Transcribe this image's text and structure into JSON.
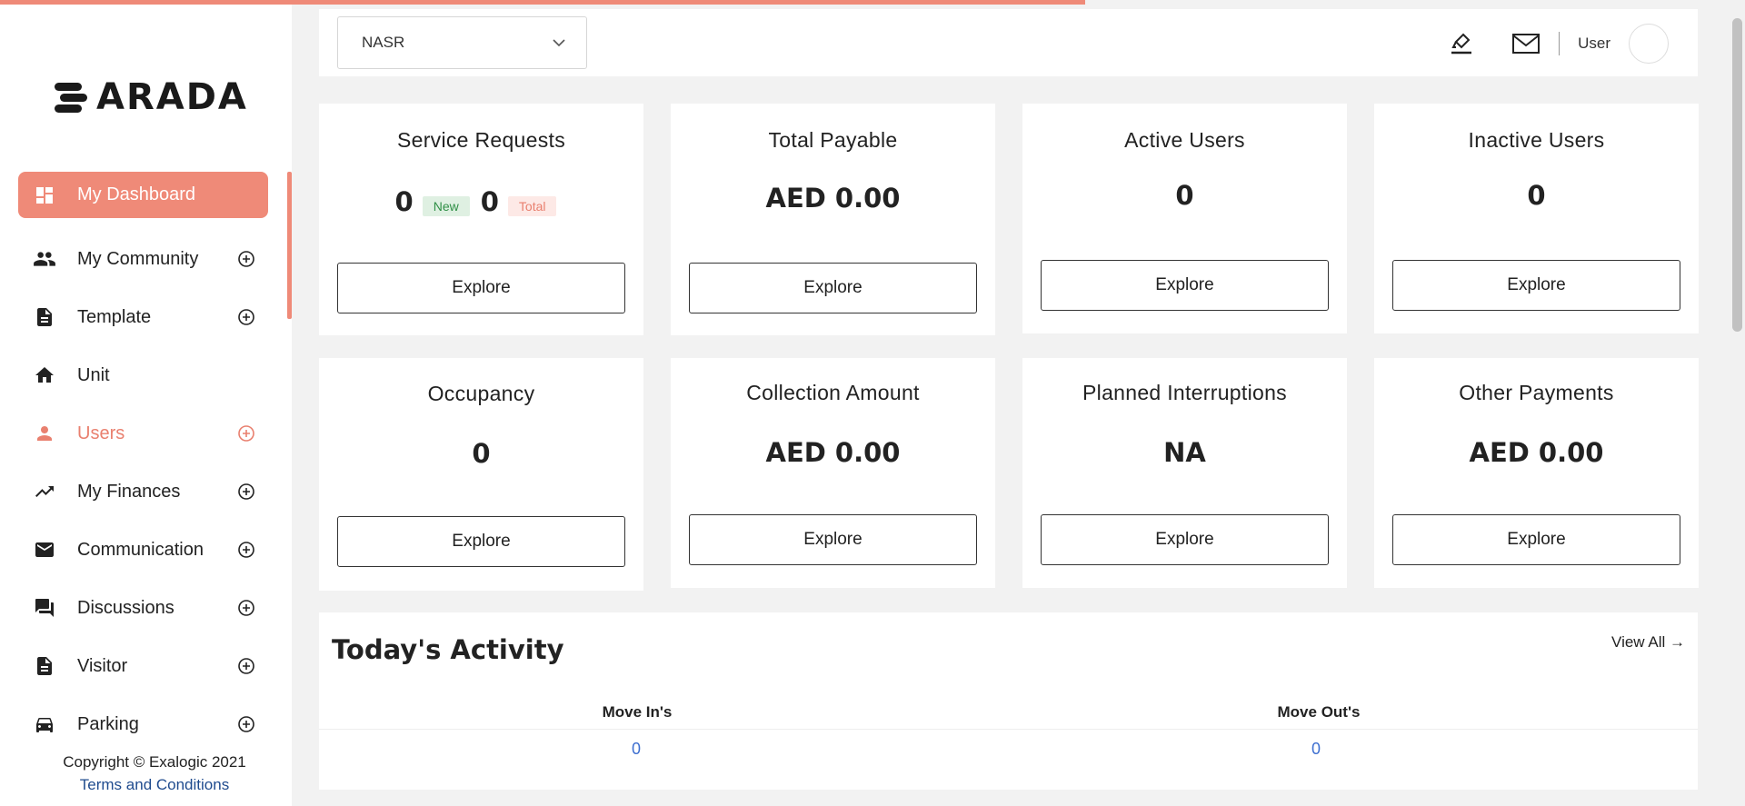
{
  "colors": {
    "accent": "#ef8a78",
    "link": "#1f4b8e",
    "value_link": "#3d6fd0"
  },
  "logo": {
    "text": "ARADA",
    "icon": "arada-logo-mark"
  },
  "sidebar": {
    "items": [
      {
        "label": "My Dashboard",
        "icon": "dashboard-icon",
        "expandable": false,
        "active": true
      },
      {
        "label": "My Community",
        "icon": "people-icon",
        "expandable": true
      },
      {
        "label": "Template",
        "icon": "document-icon",
        "expandable": true
      },
      {
        "label": "Unit",
        "icon": "home-icon",
        "expandable": false
      },
      {
        "label": "Users",
        "icon": "person-icon",
        "expandable": true,
        "highlight": true
      },
      {
        "label": "My Finances",
        "icon": "trending-up-icon",
        "expandable": true
      },
      {
        "label": "Communication",
        "icon": "mail-icon",
        "expandable": true
      },
      {
        "label": "Discussions",
        "icon": "forum-icon",
        "expandable": true
      },
      {
        "label": "Visitor",
        "icon": "document-icon",
        "expandable": true
      },
      {
        "label": "Parking",
        "icon": "car-icon",
        "expandable": true
      }
    ]
  },
  "footer": {
    "copyright": "Copyright © Exalogic 2021",
    "terms": "Terms and Conditions"
  },
  "header": {
    "community_select": "NASR",
    "user_name": "User",
    "icons": [
      "brush-icon",
      "mail-icon"
    ]
  },
  "cards": {
    "service_requests": {
      "title": "Service Requests",
      "new_count": "0",
      "new_label": "New",
      "total_count": "0",
      "total_label": "Total",
      "button": "Explore"
    },
    "total_payable": {
      "title": "Total Payable",
      "value": "AED 0.00",
      "button": "Explore"
    },
    "active_users": {
      "title": "Active Users",
      "value": "0",
      "button": "Explore"
    },
    "inactive_users": {
      "title": "Inactive Users",
      "value": "0",
      "button": "Explore"
    },
    "occupancy": {
      "title": "Occupancy",
      "value": "0",
      "button": "Explore"
    },
    "collection_amount": {
      "title": "Collection Amount",
      "value": "AED 0.00",
      "button": "Explore"
    },
    "planned_interruptions": {
      "title": "Planned Interruptions",
      "value": "NA",
      "button": "Explore"
    },
    "other_payments": {
      "title": "Other Payments",
      "value": "AED 0.00",
      "button": "Explore"
    }
  },
  "activity": {
    "title": "Today's Activity",
    "view_all": "View All",
    "move_ins_label": "Move In's",
    "move_ins_value": "0",
    "move_outs_label": "Move Out's",
    "move_outs_value": "0"
  }
}
